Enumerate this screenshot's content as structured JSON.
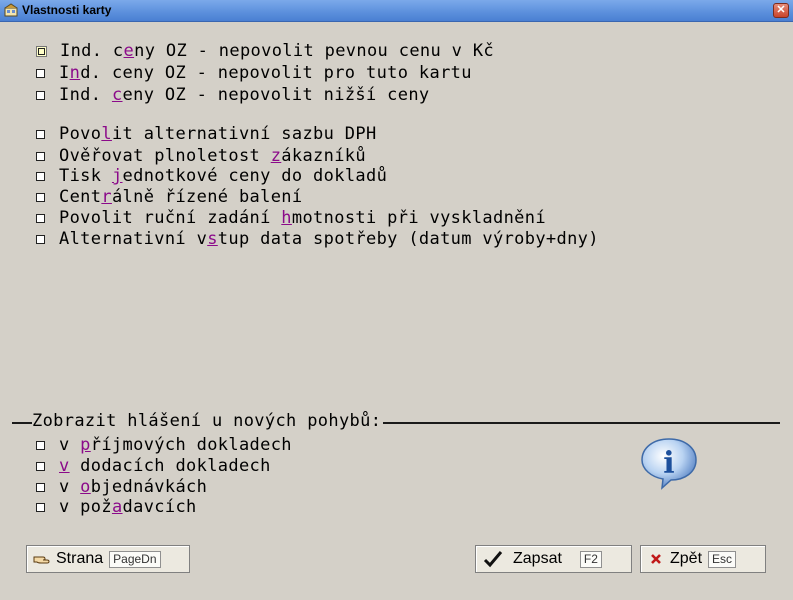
{
  "window": {
    "title": "Vlastnosti karty",
    "close_glyph": "✕"
  },
  "options_group1": [
    {
      "pre": "Ind. c",
      "hk": "e",
      "post": "ny OZ - nepovolit pevnou cenu v Kč",
      "checked": false
    },
    {
      "pre": "I",
      "hk": "n",
      "post": "d. ceny OZ - nepovolit pro tuto kartu",
      "checked": false
    },
    {
      "pre": "Ind. ",
      "hk": "c",
      "post": "eny OZ - nepovolit nižší ceny",
      "checked": false
    }
  ],
  "options_group2": [
    {
      "pre": "Povo",
      "hk": "l",
      "post": "it alternativní sazbu DPH",
      "checked": false
    },
    {
      "pre": "Ověřovat plnoletost ",
      "hk": "z",
      "post": "ákazníků",
      "checked": false
    },
    {
      "pre": "Tisk ",
      "hk": "j",
      "post": "ednotkové ceny do dokladů",
      "checked": false
    },
    {
      "pre": "Cent",
      "hk": "r",
      "post": "álně řízené balení",
      "checked": false
    },
    {
      "pre": "Povolit ruční zadání ",
      "hk": "h",
      "post": "motnosti při vyskladnění",
      "checked": false
    },
    {
      "pre": "Alternativní v",
      "hk": "s",
      "post": "tup data spotřeby (datum výroby+dny)",
      "checked": false
    }
  ],
  "notify_group": {
    "label": "Zobrazit hlášení u nových pohybů:",
    "items": [
      {
        "pre": "v ",
        "hk": "p",
        "post": "říjmových dokladech",
        "checked": false
      },
      {
        "pre": "",
        "hk": "v",
        "post": " dodacích dokladech",
        "checked": false
      },
      {
        "pre": "v ",
        "hk": "o",
        "post": "bjednávkách",
        "checked": false
      },
      {
        "pre": "v pož",
        "hk": "a",
        "post": "davcích",
        "checked": false
      }
    ]
  },
  "buttons": {
    "page": {
      "label": "Strana",
      "key": "PageDn",
      "icon": "hand-pointer-icon"
    },
    "save": {
      "label": "Zapsat",
      "key": "F2",
      "icon": "checkmark-icon"
    },
    "back": {
      "label": "Zpět",
      "key": "Esc",
      "icon": "cross-icon"
    }
  },
  "info_icon": {
    "glyph": "i",
    "icon": "info-bubble-icon"
  },
  "colors": {
    "hotkey": "#8b0a8a",
    "background": "#d4d0c8",
    "titlebar": "#5b8fdc"
  }
}
